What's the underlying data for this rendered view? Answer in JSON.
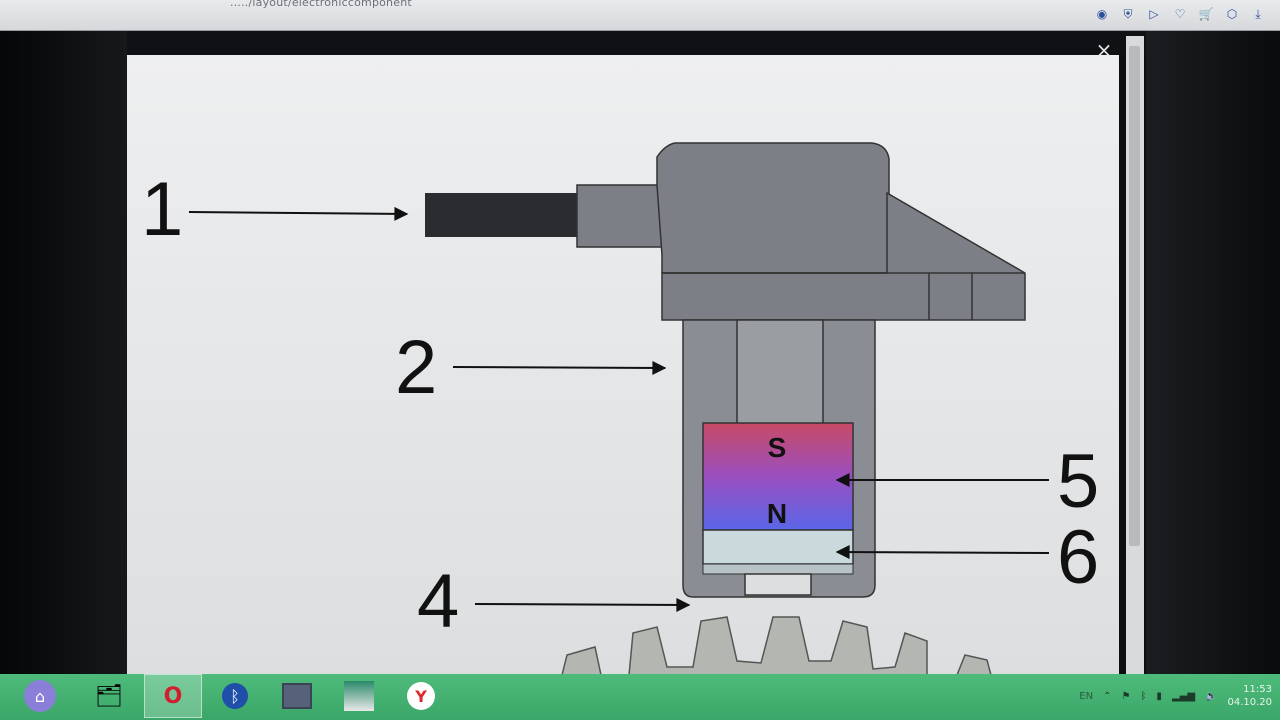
{
  "browser": {
    "url": "...../layout/electroniccomponent",
    "toolbar_icons": [
      "camera-icon",
      "shield-icon",
      "play-icon",
      "heart-icon",
      "cart-icon",
      "cube-icon",
      "download-icon"
    ]
  },
  "modal": {
    "close_label": "×"
  },
  "diagram": {
    "labels": {
      "l1": "1",
      "l2": "2",
      "l4": "4",
      "l5": "5",
      "l6": "6"
    },
    "magnet": {
      "south": "S",
      "north": "N"
    },
    "colors": {
      "housing": "#7c8086",
      "cable": "#2b2c2f",
      "magnet_top": "#c44a6a",
      "magnet_bottom": "#5a66e6",
      "sensor": "#c9d9dc",
      "gear": "#b4b6b2"
    }
  },
  "taskbar": {
    "apps": [
      "files-icon",
      "opera-icon",
      "bluetooth-icon",
      "window-icon",
      "app-icon",
      "yandex-icon"
    ],
    "language": "EN",
    "time": "11:53",
    "date": "04.10.20"
  }
}
